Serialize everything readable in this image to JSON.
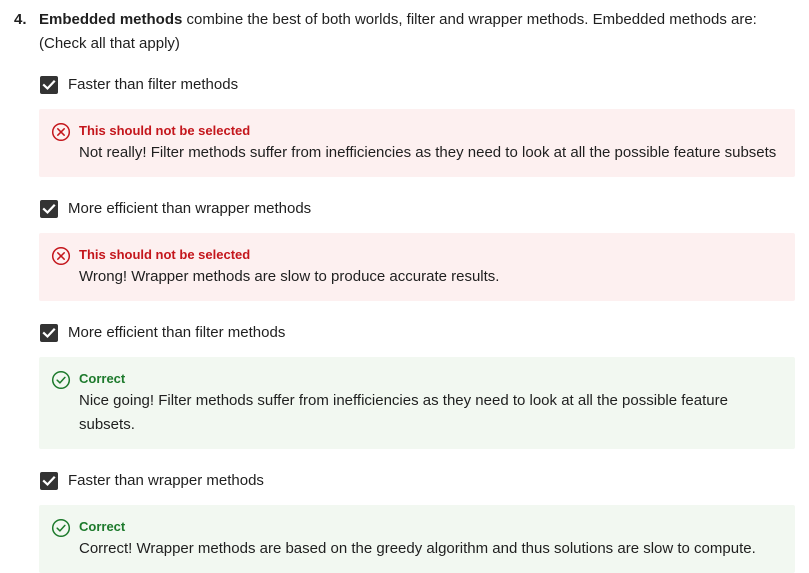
{
  "question": {
    "number": "4.",
    "bold_lead": "Embedded methods",
    "text_rest": " combine the best of both worlds, filter and wrapper methods. Embedded methods are: (Check all that apply)"
  },
  "options": [
    {
      "label": "Faster than filter methods",
      "checked": true,
      "feedback": {
        "status": "wrong",
        "title": "This should not be selected",
        "text": "Not really! Filter methods suffer from inefficiencies as they need to look at all the possible feature subsets"
      }
    },
    {
      "label": "More efficient than wrapper methods",
      "checked": true,
      "feedback": {
        "status": "wrong",
        "title": "This should not be selected",
        "text": "Wrong! Wrapper methods are slow to produce accurate results."
      }
    },
    {
      "label": "More efficient than filter methods",
      "checked": true,
      "feedback": {
        "status": "right",
        "title": "Correct",
        "text": "Nice going! Filter methods suffer from inefficiencies as they need to look at all the possible feature subsets."
      }
    },
    {
      "label": "Faster than wrapper methods",
      "checked": true,
      "feedback": {
        "status": "right",
        "title": "Correct",
        "text": "Correct! Wrapper methods are based  on the greedy algorithm and thus solutions are slow to compute."
      }
    }
  ],
  "icons": {
    "checkbox": "checkmark-icon",
    "wrong": "x-circle-icon",
    "right": "check-circle-icon"
  },
  "colors": {
    "checkbox_fill": "#333333",
    "wrong_bg": "#fdf0f0",
    "wrong_accent": "#c4161c",
    "right_bg": "#f2f8f1",
    "right_accent": "#1d7a2c"
  }
}
